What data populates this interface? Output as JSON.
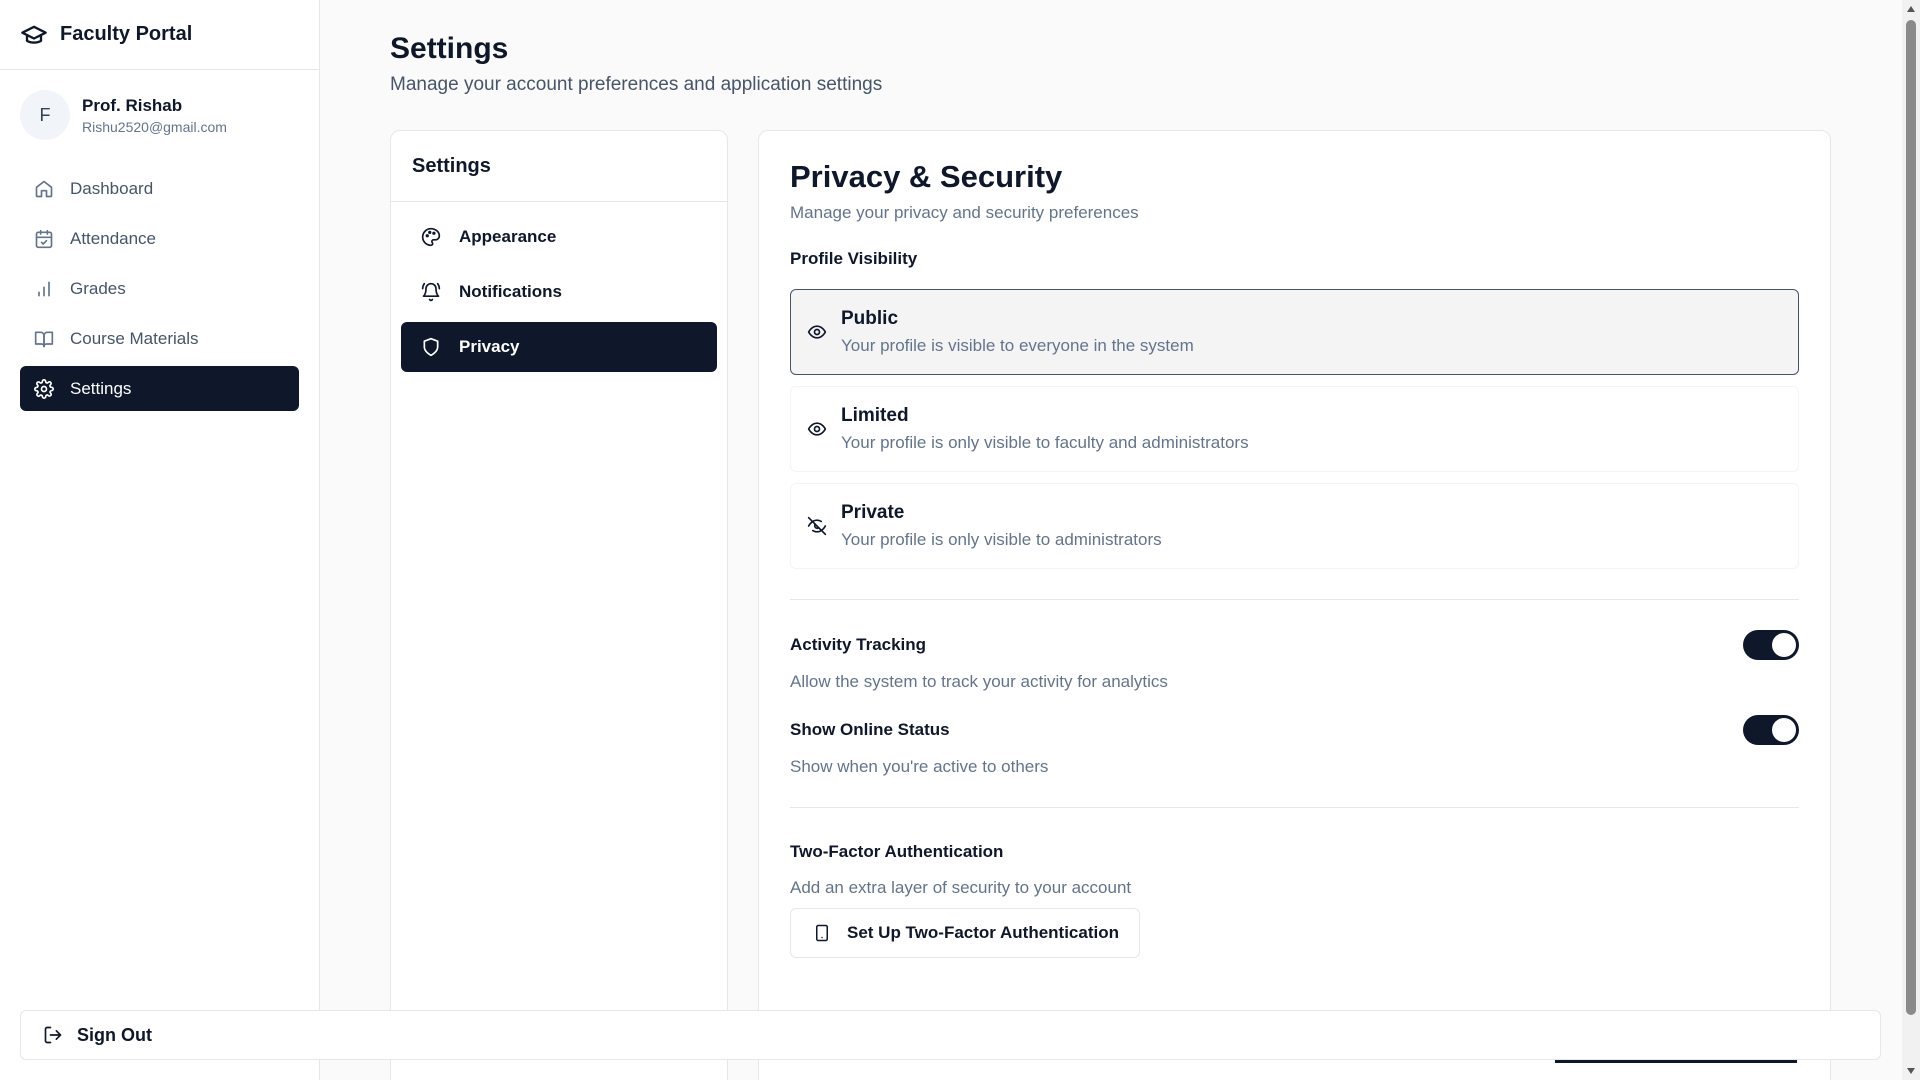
{
  "app": {
    "title": "Faculty Portal"
  },
  "user": {
    "initial": "F",
    "name": "Prof. Rishab",
    "email": "Rishu2520@gmail.com"
  },
  "sidebar": {
    "items": [
      {
        "label": "Dashboard",
        "icon": "home-icon"
      },
      {
        "label": "Attendance",
        "icon": "calendar-icon"
      },
      {
        "label": "Grades",
        "icon": "bar-chart-icon"
      },
      {
        "label": "Course Materials",
        "icon": "book-icon"
      },
      {
        "label": "Settings",
        "icon": "gear-icon",
        "active": true
      }
    ]
  },
  "page": {
    "title": "Settings",
    "subtitle": "Manage your account preferences and application settings"
  },
  "settings_nav": {
    "header": "Settings",
    "items": [
      {
        "label": "Appearance",
        "icon": "palette-icon"
      },
      {
        "label": "Notifications",
        "icon": "bell-icon"
      },
      {
        "label": "Privacy",
        "icon": "shield-icon",
        "active": true
      }
    ]
  },
  "privacy": {
    "title": "Privacy & Security",
    "subtitle": "Manage your privacy and security preferences",
    "visibility_label": "Profile Visibility",
    "options": [
      {
        "title": "Public",
        "desc": "Your profile is visible to everyone in the system",
        "icon": "eye-icon",
        "selected": true
      },
      {
        "title": "Limited",
        "desc": "Your profile is only visible to faculty and administrators",
        "icon": "eye-icon",
        "selected": false
      },
      {
        "title": "Private",
        "desc": "Your profile is only visible to administrators",
        "icon": "eye-off-icon",
        "selected": false
      }
    ],
    "toggles": [
      {
        "title": "Activity Tracking",
        "desc": "Allow the system to track your activity for analytics",
        "on": true
      },
      {
        "title": "Show Online Status",
        "desc": "Show when you're active to others",
        "on": true
      }
    ],
    "two_factor": {
      "title": "Two-Factor Authentication",
      "desc": "Add an extra layer of security to your account",
      "button_label": "Set Up Two-Factor Authentication",
      "icon": "smartphone-icon"
    }
  },
  "signout": {
    "label": "Sign Out",
    "icon": "logout-icon"
  },
  "colors": {
    "primary": "#0f172a",
    "muted_text": "#64748b",
    "border": "#e5e7eb"
  }
}
